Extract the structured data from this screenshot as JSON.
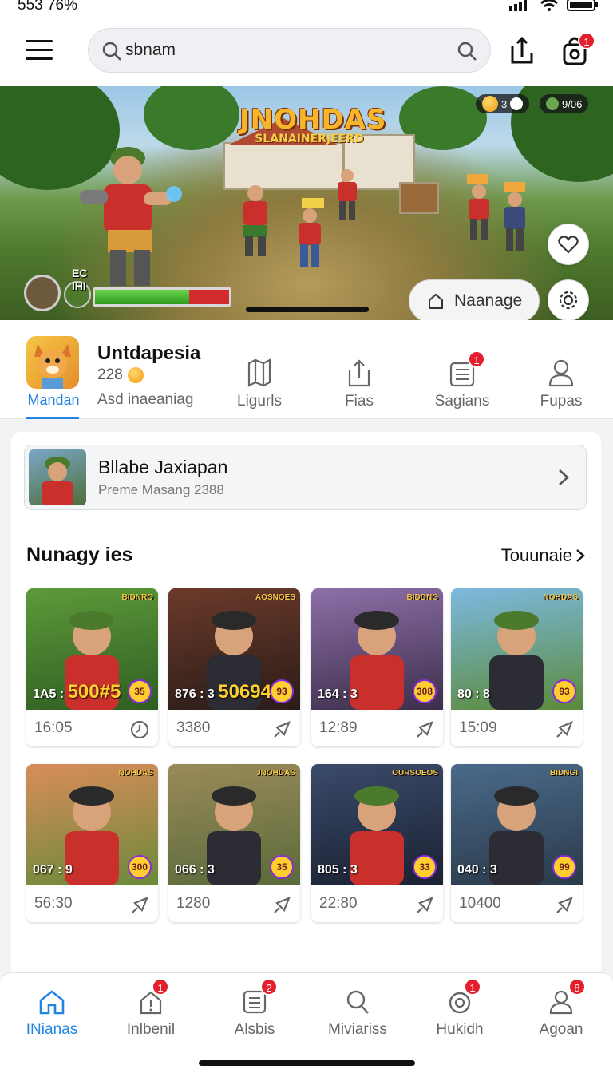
{
  "status_bar": {
    "time": "553 76%"
  },
  "header": {
    "search_value": "sbnam",
    "upload_badge": "",
    "bag_badge": "1"
  },
  "hero": {
    "title": "JNOHDAS",
    "subtitle": "SLANAINERJEERD",
    "hud_left": "3",
    "hud_right": "9/06",
    "player_label": "EC IHI",
    "manage_label": "Naanage",
    "hp_percent": 70
  },
  "profile": {
    "app_label": "Mandan",
    "name": "Untdapesia",
    "coins": "228",
    "subtitle": "Asd inaeaniag",
    "tabs": [
      {
        "label": "Ligurls",
        "badge": ""
      },
      {
        "label": "Fias",
        "badge": ""
      },
      {
        "label": "Sagians",
        "badge": "1"
      },
      {
        "label": "Fupas",
        "badge": ""
      }
    ]
  },
  "featured": {
    "title": "Bllabe Jaxiapan",
    "subtitle": "Preme Masang 2388"
  },
  "section": {
    "title": "Nunagy ies",
    "link": "Touunaie"
  },
  "games": [
    {
      "tag": "BIDNRO",
      "score_small": "1A5 :",
      "score_big": "500#5",
      "emoji": "35",
      "time": "16:05",
      "icon": "clock-icon"
    },
    {
      "tag": "AOSNOES",
      "score_small": "876 : 3",
      "score_big": "50694",
      "emoji": "93",
      "time": "3380",
      "icon": "share-icon"
    },
    {
      "tag": "BIDDNG",
      "score_small": "164 : 3",
      "score_big": "",
      "emoji": "308",
      "time": "12:89",
      "icon": "share-icon"
    },
    {
      "tag": "NOHDAS",
      "score_small": "80 : 8",
      "score_big": "",
      "emoji": "93",
      "time": "15:09",
      "icon": "share-icon"
    },
    {
      "tag": "NOHDAS",
      "score_small": "067 : 9",
      "score_big": "",
      "emoji": "300",
      "time": "56:30",
      "icon": "share-icon"
    },
    {
      "tag": "JNOHDAS",
      "score_small": "066 : 3",
      "score_big": "",
      "emoji": "35",
      "time": "1280",
      "icon": "share-icon"
    },
    {
      "tag": "OURSOEOS",
      "score_small": "805 : 3",
      "score_big": "",
      "emoji": "33",
      "time": "22:80",
      "icon": "share-icon"
    },
    {
      "tag": "BIDNGI",
      "score_small": "040 : 3",
      "score_big": "",
      "emoji": "99",
      "time": "10400",
      "icon": "share-icon"
    }
  ],
  "bottom_nav": [
    {
      "label": "INianas",
      "badge": ""
    },
    {
      "label": "Inlbenil",
      "badge": "1"
    },
    {
      "label": "Alsbis",
      "badge": "2"
    },
    {
      "label": "Miviariss",
      "badge": ""
    },
    {
      "label": "Hukidh",
      "badge": "1"
    },
    {
      "label": "Agoan",
      "badge": "8"
    }
  ],
  "colors": {
    "accent": "#2584e0",
    "badge": "#e5202e",
    "coin": "#f09a12"
  }
}
